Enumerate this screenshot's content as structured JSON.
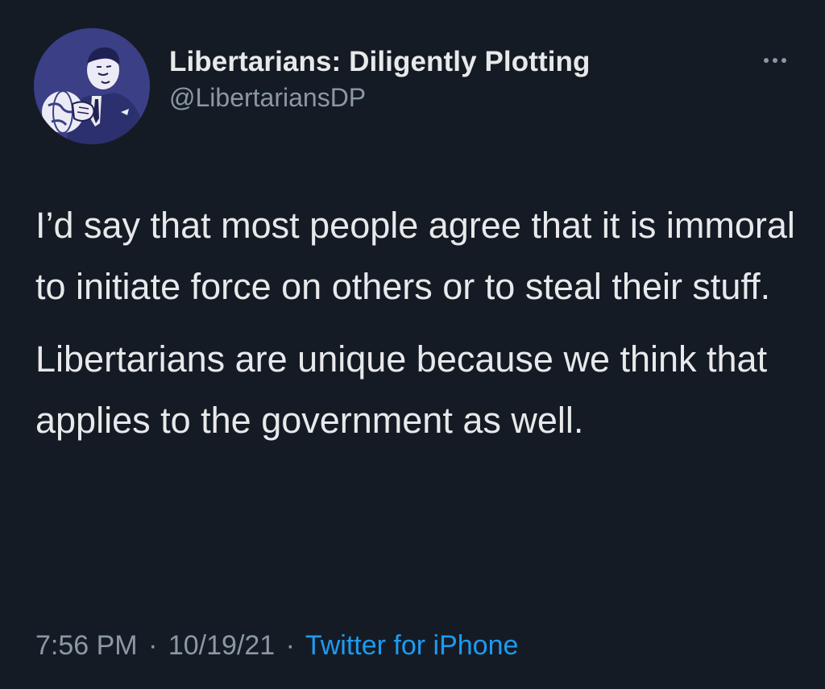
{
  "tweet": {
    "display_name": "Libertarians: Diligently Plotting",
    "handle": "@LibertariansDP",
    "paragraphs": [
      "I’d say that most people agree that it is immoral to initiate force on others or to steal their stuff.",
      "Libertarians are unique because we think that applies to the government as well."
    ],
    "time": "7:56 PM",
    "date": "10/19/21",
    "separator": "·",
    "source": "Twitter for iPhone",
    "more_icon": "more-horizontal-icon",
    "avatar_icon": "vintage-man-holding-globe-illustration"
  },
  "colors": {
    "background": "#151b25",
    "text": "#e7e9ea",
    "secondary": "#8b98a5",
    "link": "#1d9bf0",
    "avatar_bg": "#3a3f86"
  }
}
